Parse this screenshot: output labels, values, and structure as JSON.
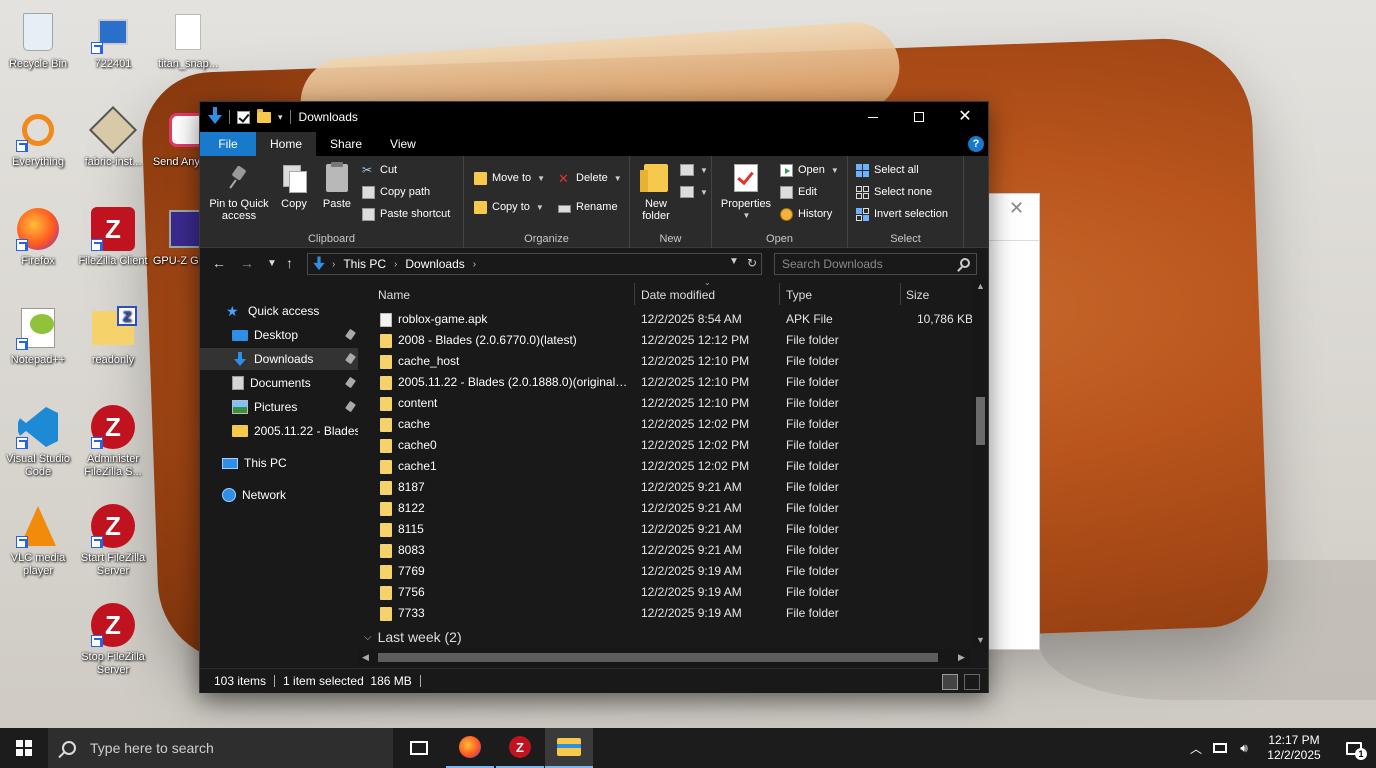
{
  "desktop": {
    "icons": [
      {
        "label": "Recycle Bin"
      },
      {
        "label": "722401"
      },
      {
        "label": "titan_snap..."
      },
      {
        "label": "Everything"
      },
      {
        "label": "fabric-inst..."
      },
      {
        "label": "Send Anywh..."
      },
      {
        "label": "Firefox"
      },
      {
        "label": "FileZilla Client"
      },
      {
        "label": "GPU-Z GPU..."
      },
      {
        "label": "Notepad++"
      },
      {
        "label": "readonly"
      },
      {
        "label": "Visual Studio Code"
      },
      {
        "label": "Administer FileZilla S..."
      },
      {
        "label": "VLC media player"
      },
      {
        "label": "Start FileZilla Server"
      },
      {
        "label": "Stop FileZilla Server"
      }
    ]
  },
  "explorer": {
    "title": "Downloads",
    "tabs": [
      {
        "label": "File"
      },
      {
        "label": "Home"
      },
      {
        "label": "Share"
      },
      {
        "label": "View"
      }
    ],
    "help_glyph": "?",
    "ribbon": {
      "clipboard": {
        "label": "Clipboard",
        "pin": "Pin to Quick access",
        "copy": "Copy",
        "paste": "Paste",
        "cut": "Cut",
        "copy_path": "Copy path",
        "paste_shortcut": "Paste shortcut"
      },
      "organize": {
        "label": "Organize",
        "move_to": "Move to",
        "copy_to": "Copy to",
        "delete": "Delete",
        "rename": "Rename"
      },
      "new": {
        "label": "New",
        "new_folder": "New folder"
      },
      "open": {
        "label": "Open",
        "properties": "Properties",
        "open": "Open",
        "edit": "Edit",
        "history": "History"
      },
      "select": {
        "label": "Select",
        "select_all": "Select all",
        "select_none": "Select none",
        "invert_selection": "Invert selection"
      }
    },
    "address": {
      "crumbs": [
        "This PC",
        "Downloads"
      ],
      "search_placeholder": "Search Downloads"
    },
    "nav": {
      "items": [
        {
          "label": "Quick access"
        },
        {
          "label": "Desktop"
        },
        {
          "label": "Downloads"
        },
        {
          "label": "Documents"
        },
        {
          "label": "Pictures"
        },
        {
          "label": "2005.11.22 - Blades"
        },
        {
          "label": "This PC"
        },
        {
          "label": "Network"
        }
      ]
    },
    "columns": {
      "name": "Name",
      "date": "Date modified",
      "type": "Type",
      "size": "Size"
    },
    "files": [
      {
        "name": "roblox-game.apk",
        "date": "12/2/2025 8:54 AM",
        "type": "APK File",
        "size": "10,786 KB",
        "kind": "file"
      },
      {
        "name": "2008 - Blades (2.0.6770.0)(latest)",
        "date": "12/2/2025 12:12 PM",
        "type": "File folder",
        "size": "",
        "kind": "folder"
      },
      {
        "name": "cache_host",
        "date": "12/2/2025 12:10 PM",
        "type": "File folder",
        "size": "",
        "kind": "folder"
      },
      {
        "name": "2005.11.22 - Blades (2.0.1888.0)(original s...",
        "date": "12/2/2025 12:10 PM",
        "type": "File folder",
        "size": "",
        "kind": "folder"
      },
      {
        "name": "content",
        "date": "12/2/2025 12:10 PM",
        "type": "File folder",
        "size": "",
        "kind": "folder"
      },
      {
        "name": "cache",
        "date": "12/2/2025 12:02 PM",
        "type": "File folder",
        "size": "",
        "kind": "folder"
      },
      {
        "name": "cache0",
        "date": "12/2/2025 12:02 PM",
        "type": "File folder",
        "size": "",
        "kind": "folder"
      },
      {
        "name": "cache1",
        "date": "12/2/2025 12:02 PM",
        "type": "File folder",
        "size": "",
        "kind": "folder"
      },
      {
        "name": "8187",
        "date": "12/2/2025 9:21 AM",
        "type": "File folder",
        "size": "",
        "kind": "folder"
      },
      {
        "name": "8122",
        "date": "12/2/2025 9:21 AM",
        "type": "File folder",
        "size": "",
        "kind": "folder"
      },
      {
        "name": "8115",
        "date": "12/2/2025 9:21 AM",
        "type": "File folder",
        "size": "",
        "kind": "folder"
      },
      {
        "name": "8083",
        "date": "12/2/2025 9:21 AM",
        "type": "File folder",
        "size": "",
        "kind": "folder"
      },
      {
        "name": "7769",
        "date": "12/2/2025 9:19 AM",
        "type": "File folder",
        "size": "",
        "kind": "folder"
      },
      {
        "name": "7756",
        "date": "12/2/2025 9:19 AM",
        "type": "File folder",
        "size": "",
        "kind": "folder"
      },
      {
        "name": "7733",
        "date": "12/2/2025 9:19 AM",
        "type": "File folder",
        "size": "",
        "kind": "folder"
      }
    ],
    "group_header": "Last week (2)",
    "status": {
      "items_count": "103 items",
      "selection": "1 item selected  186 MB"
    }
  },
  "taskbar": {
    "search_placeholder": "Type here to search",
    "time": "12:17 PM",
    "date": "12/2/2025",
    "notification_count": "1"
  },
  "colors": {
    "accent": "#1979ca",
    "folder": "#f6c84b",
    "dark_bg": "#191919",
    "ribbon_bg": "#2b2b2b"
  }
}
